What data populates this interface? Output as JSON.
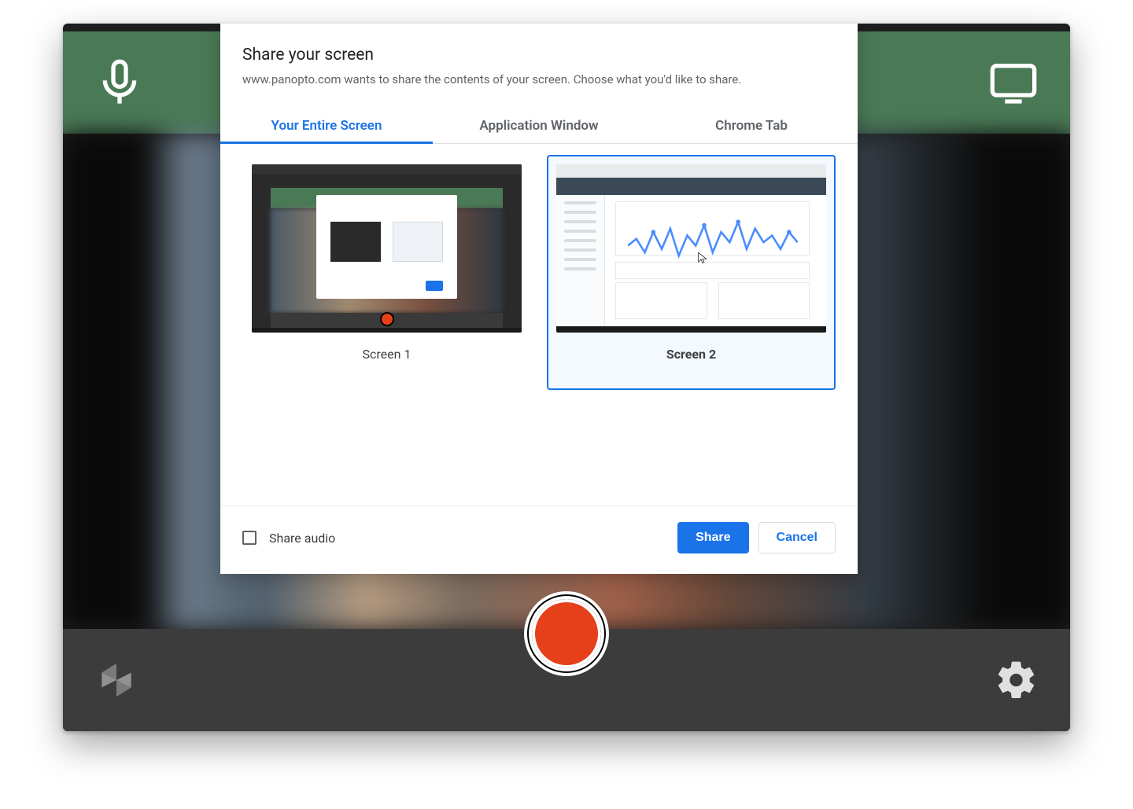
{
  "modal": {
    "title": "Share your screen",
    "description": "www.panopto.com wants to share the contents of your screen. Choose what you'd like to share.",
    "tabs": [
      {
        "label": "Your Entire Screen",
        "active": true
      },
      {
        "label": "Application Window",
        "active": false
      },
      {
        "label": "Chrome Tab",
        "active": false
      }
    ],
    "screens": [
      {
        "label": "Screen 1",
        "selected": false
      },
      {
        "label": "Screen 2",
        "selected": true
      }
    ],
    "share_audio_label": "Share audio",
    "share_button": "Share",
    "cancel_button": "Cancel"
  },
  "icons": {
    "mic": "microphone-icon",
    "screen": "screen-share-icon",
    "logo": "panopto-logo-icon",
    "gear": "settings-gear-icon",
    "record": "record-button",
    "cursor": "cursor-icon"
  },
  "colors": {
    "accent": "#1a73e8",
    "record": "#e6401a",
    "topbar": "#4a7a55",
    "bottombar": "#3c3c3c"
  }
}
